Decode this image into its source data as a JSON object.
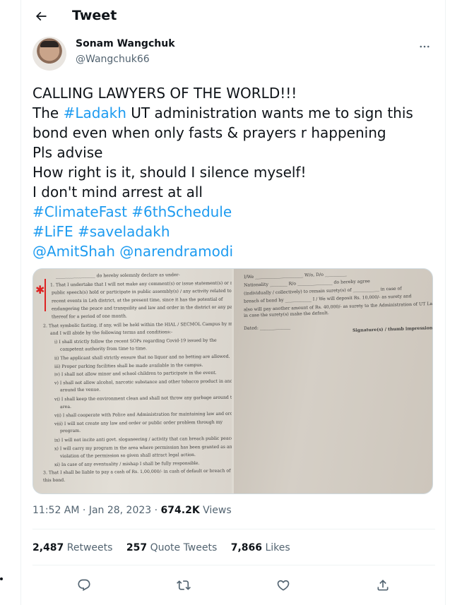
{
  "header": {
    "title": "Tweet",
    "back_icon": "arrow-left-icon"
  },
  "author": {
    "name": "Sonam Wangchuk",
    "handle": "@Wangchuk66"
  },
  "tweet": {
    "line1": "CALLING LAWYERS OF THE WORLD!!!",
    "line2_pre": "The ",
    "line2_tag": "#Ladakh",
    "line2_post": " UT administration wants me to sign this",
    "line3": "bond even when only fasts & prayers r happening",
    "line4": "Pls advise",
    "line5": "How right is it, should I silence myself!",
    "line6": "I don't mind arrest at all",
    "tag_climatefast": "#ClimateFast",
    "tag_6thschedule": "#6thSchedule",
    "tag_life": "#LiFE",
    "tag_saveladakh": "#saveladakh",
    "mention_amitshah": "@AmitShah",
    "mention_narendramodi": "@narendramodi"
  },
  "document_left": [
    "__________________ do hereby solemnly declare as under-",
    "1. That I undertake that I will not make any comment(s) or issue statement(s) or make",
    "public speech(s) hold or participate in public assembly(s) / any activity related to the",
    "recent events in Leh district, at the present time, since it has the potential of",
    "endangering the peace and tranquility and law and order in the district or any part",
    "thereof for a period of one month.",
    "2. That symbolic fasting, if any, will be held within the HIAL / SECMOL Campus by me",
    "and I will abide by the following terms and conditions:-",
    "i) I shall strictly follow the recent SOPs regarding Covid-19 issued by the",
    "competent authority from time to time.",
    "ii) The applicant shall strictly ensure that no liquor and no betting are allowed.",
    "iii) Proper parking facilities shall be made available in the campus.",
    "iv) I shall not allow minor and school children to participate in the event.",
    "v) I shall not allow alcohol, narcotic substance and other tobacco product in and",
    "around the venue.",
    "vi) I shall keep the environment clean and shall not throw any garbage around the",
    "area.",
    "vii) I shall cooperate with Police and Administration for maintaining law and order.",
    "viii) I will not create any law and order or public order problem through my",
    "program.",
    "ix) I will not incite anti govt. sloganeering / activity that can breach public peace.",
    "x) I will carry my program in the area where permission has been granted as any",
    "violation of the permission so given shall attract legal action.",
    "xi) In case of any eventuality / mishap I shall be fully responsible.",
    "3. That I shall be liable to pay a cash of Rs. 1,00,000/- in cash of default or breach of",
    "this bond."
  ],
  "document_right": [
    "I/We ______________________ W/o, D/o __________",
    "Nationality ________ R/o ________________ do hereby agree",
    "(individually / collectively) to remain surety(s) of ____________ in case of",
    "breach of bond by ____________ I / We will deposit Rs. 10,000/- as surety and",
    "also will pay another amount of Rs. 40,000/- as surety to the Administration of UT Ladakh",
    "in case the surety(s) make the default.",
    "Dated: ______________",
    "Signature(s) / thumb impression(s)"
  ],
  "meta": {
    "time": "11:52 AM",
    "separator": "·",
    "date": "Jan 28, 2023",
    "views_count": "674.2K",
    "views_label": "Views"
  },
  "stats": {
    "retweets_count": "2,487",
    "retweets_label": "Retweets",
    "quotes_count": "257",
    "quotes_label": "Quote Tweets",
    "likes_count": "7,866",
    "likes_label": "Likes"
  },
  "actions": [
    "reply-icon",
    "retweet-icon",
    "like-icon",
    "share-icon"
  ],
  "colors": {
    "accent": "#1d9bf0",
    "text": "#0f1419",
    "secondary": "#536471",
    "border": "#eff3f4"
  }
}
